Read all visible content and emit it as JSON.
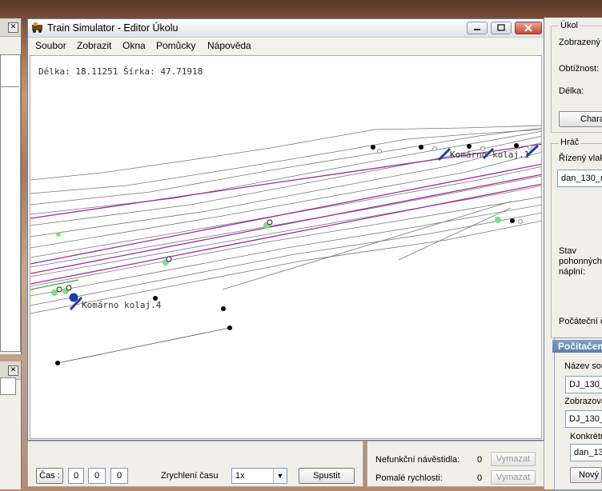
{
  "window": {
    "title": "Train Simulator - Editor Úkolu"
  },
  "menu": [
    "Soubor",
    "Zobrazit",
    "Okna",
    "Pomůcky",
    "Nápověda"
  ],
  "map": {
    "coords": "Délka: 18.11251 Šírka: 47.71918",
    "labels": [
      "Komárno kolaj.4",
      "Komárno kolaj.1"
    ]
  },
  "toolbar": {
    "time_label": "Čas :",
    "time_h": "0",
    "time_m": "0",
    "time_s": "0",
    "speed_label": "Zrychlení času",
    "speed_value": "1x",
    "start_label": "Spustit"
  },
  "status": {
    "signals_label": "Nefunkční návěstidla:",
    "signals_count": "0",
    "slow_label": "Pomalé rychlosti:",
    "slow_count": "0",
    "clear_label": "Vymazat"
  },
  "right_panel": {
    "ukol_header": "Úkol",
    "zobrazeny": "Zobrazený ú",
    "obtiznost": "Obtížnost:",
    "delka": "Délka:",
    "chara_btn": "Chara",
    "hrac_header": "Hráč",
    "rizeny": "Řízený vlak",
    "train_field": "dan_130_r",
    "stav_1": "Stav",
    "stav_2": "pohonných",
    "stav_3": "náplní:",
    "pocatecni": "Počáteční č",
    "pocitacem": "Počítačem",
    "nazev": "Název sou",
    "field1": "DJ_130_",
    "zobrazova": "Zobrazova",
    "field2": "DJ_130_",
    "konkretni": "Konkrétn",
    "field3": "dan_13",
    "novy": "Nový"
  },
  "colors": {
    "track_purple": "#a02aa0",
    "track_green": "#3aa83a",
    "signal_green": "#7ee07e",
    "marker_blue": "#1a3fa8"
  }
}
